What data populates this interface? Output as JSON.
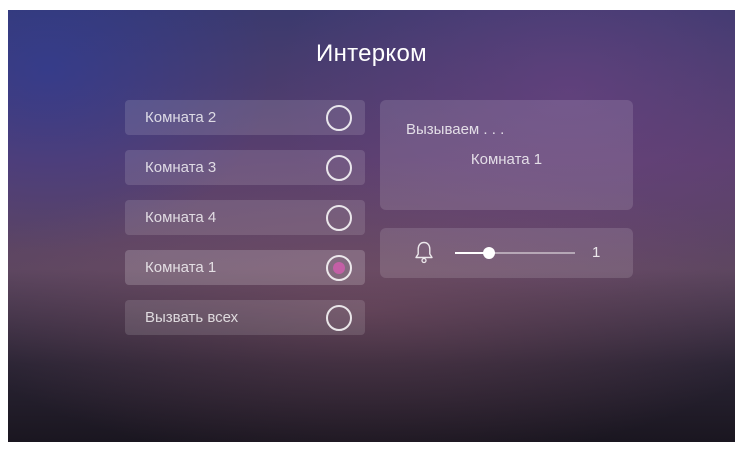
{
  "header": {
    "title": "Интерком"
  },
  "rooms": [
    {
      "label": "Комната 2",
      "selected": false
    },
    {
      "label": "Комната 3",
      "selected": false
    },
    {
      "label": "Комната 4",
      "selected": false
    },
    {
      "label": "Комната 1",
      "selected": true
    },
    {
      "label": "Вызвать всех",
      "selected": false
    }
  ],
  "call": {
    "status": "Вызываем . . .",
    "target": "Комната 1"
  },
  "volume": {
    "icon": "bell-icon",
    "value": "1",
    "level_percent": 28
  },
  "colors": {
    "accent": "#c45fa6"
  }
}
